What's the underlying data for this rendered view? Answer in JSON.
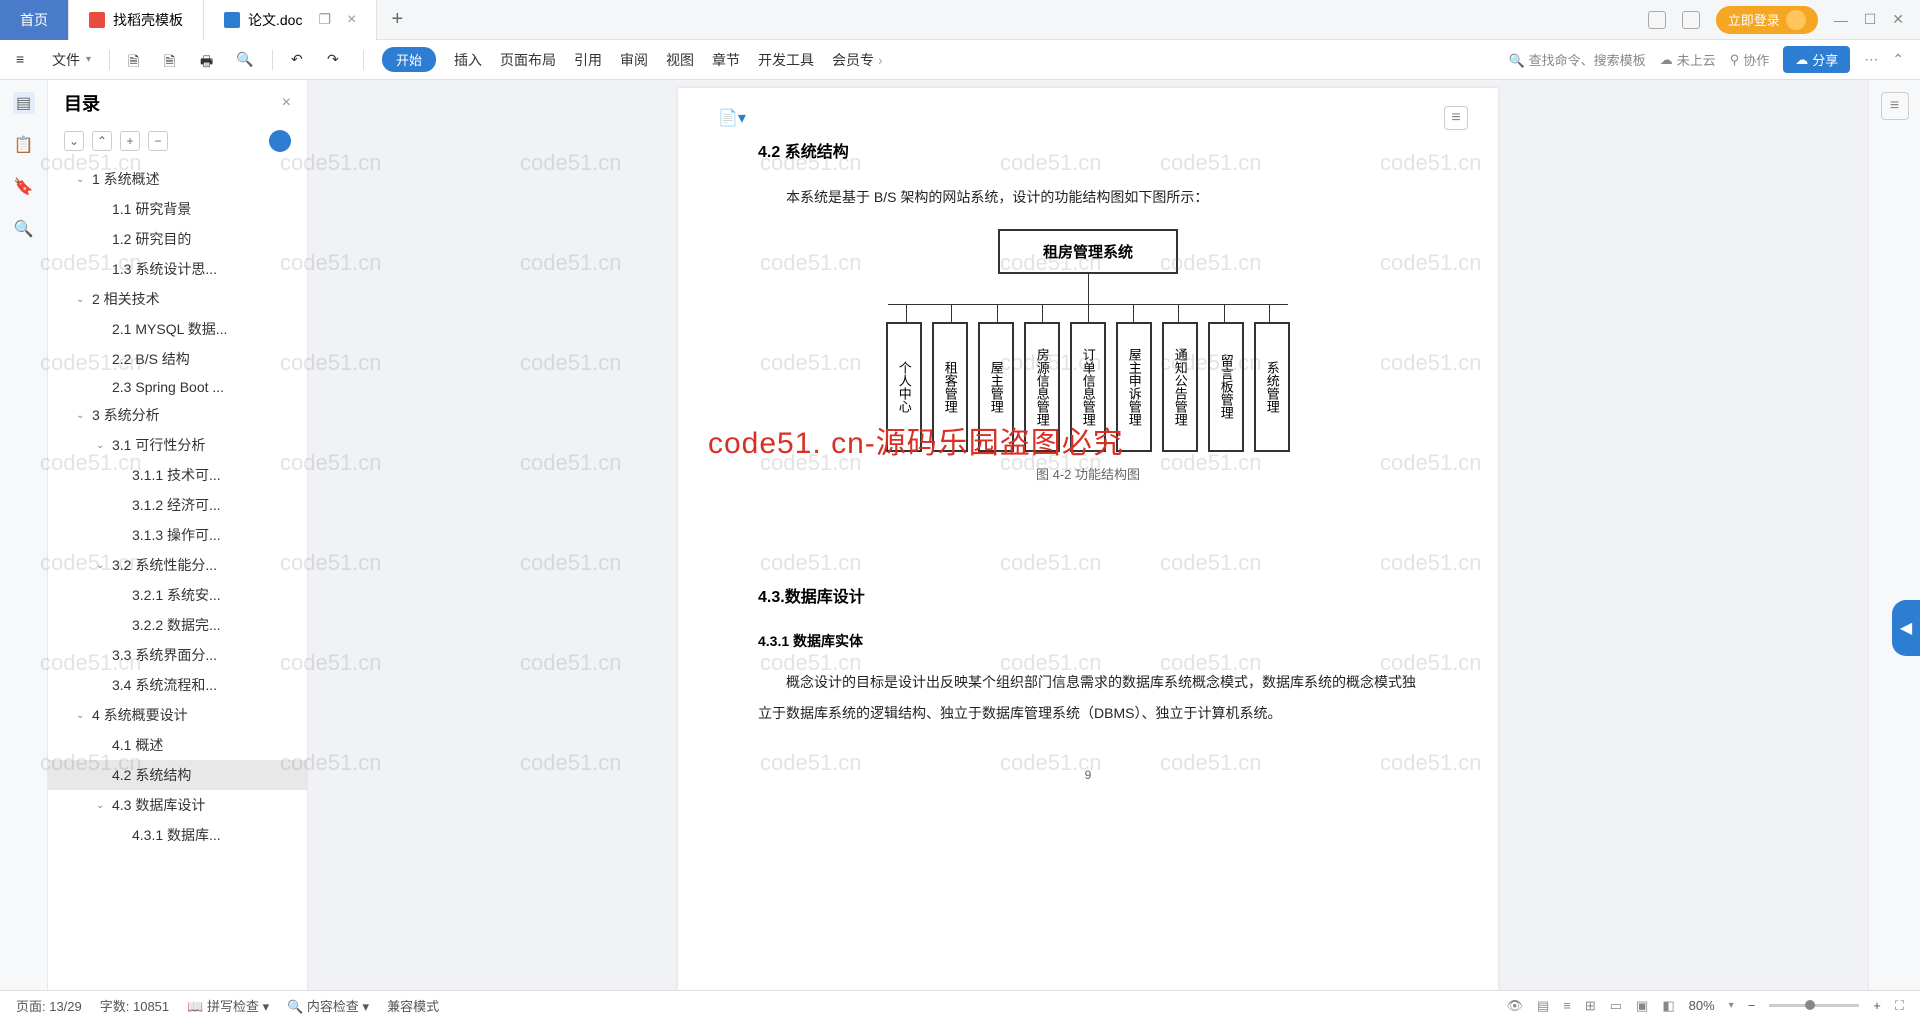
{
  "tabs": {
    "home": "首页",
    "template": "找稻壳模板",
    "doc": "论文.doc"
  },
  "login_label": "立即登录",
  "file_menu": "文件",
  "ribbon": {
    "start": "开始",
    "insert": "插入",
    "page_layout": "页面布局",
    "reference": "引用",
    "review": "审阅",
    "view": "视图",
    "chapter": "章节",
    "dev_tools": "开发工具",
    "member": "会员专"
  },
  "search_placeholder": "查找命令、搜索模板",
  "cloud_status": "未上云",
  "collaborate": "协作",
  "share": "分享",
  "outline": {
    "title": "目录",
    "items": [
      {
        "level": 1,
        "text": "1 系统概述",
        "chevron": true
      },
      {
        "level": 2,
        "text": "1.1 研究背景"
      },
      {
        "level": 2,
        "text": "1.2 研究目的"
      },
      {
        "level": 2,
        "text": "1.3 系统设计思..."
      },
      {
        "level": 1,
        "text": "2 相关技术",
        "chevron": true
      },
      {
        "level": 2,
        "text": "2.1 MYSQL 数据..."
      },
      {
        "level": 2,
        "text": "2.2 B/S 结构"
      },
      {
        "level": 2,
        "text": "2.3 Spring Boot ..."
      },
      {
        "level": 1,
        "text": "3 系统分析",
        "chevron": true
      },
      {
        "level": 2,
        "text": "3.1 可行性分析",
        "chevron": true
      },
      {
        "level": 3,
        "text": "3.1.1 技术可..."
      },
      {
        "level": 3,
        "text": "3.1.2 经济可..."
      },
      {
        "level": 3,
        "text": "3.1.3 操作可..."
      },
      {
        "level": 2,
        "text": "3.2 系统性能分...",
        "chevron": true
      },
      {
        "level": 3,
        "text": "3.2.1 系统安..."
      },
      {
        "level": 3,
        "text": "3.2.2 数据完..."
      },
      {
        "level": 2,
        "text": "3.3 系统界面分..."
      },
      {
        "level": 2,
        "text": "3.4 系统流程和..."
      },
      {
        "level": 1,
        "text": "4 系统概要设计",
        "chevron": true
      },
      {
        "level": 2,
        "text": "4.1 概述"
      },
      {
        "level": 2,
        "text": "4.2 系统结构",
        "active": true
      },
      {
        "level": 2,
        "text": "4.3 数据库设计",
        "chevron": true
      },
      {
        "level": 3,
        "text": "4.3.1 数据库..."
      }
    ]
  },
  "doc": {
    "heading_42": "4.2 系统结构",
    "para_42": "本系统是基于 B/S 架构的网站系统，设计的功能结构图如下图所示：",
    "diagram_root": "租房管理系统",
    "diagram_boxes": [
      "个人中心",
      "租客管理",
      "屋主管理",
      "房源信息管理",
      "订单信息管理",
      "屋主申诉管理",
      "通知公告管理",
      "留言板管理",
      "系统管理"
    ],
    "diagram_caption": "图 4-2 功能结构图",
    "watermark_red": "code51. cn-源码乐园盗图必究",
    "heading_43": "4.3.数据库设计",
    "heading_431": "4.3.1 数据库实体",
    "para_431": "概念设计的目标是设计出反映某个组织部门信息需求的数据库系统概念模式，数据库系统的概念模式独立于数据库系统的逻辑结构、独立于数据库管理系统（DBMS）、独立于计算机系统。",
    "page_num": "9"
  },
  "bg_watermark": "code51.cn",
  "status": {
    "page": "页面: 13/29",
    "words": "字数: 10851",
    "spellcheck": "拼写检查",
    "content_check": "内容检查",
    "compat": "兼容模式",
    "zoom": "80%"
  }
}
